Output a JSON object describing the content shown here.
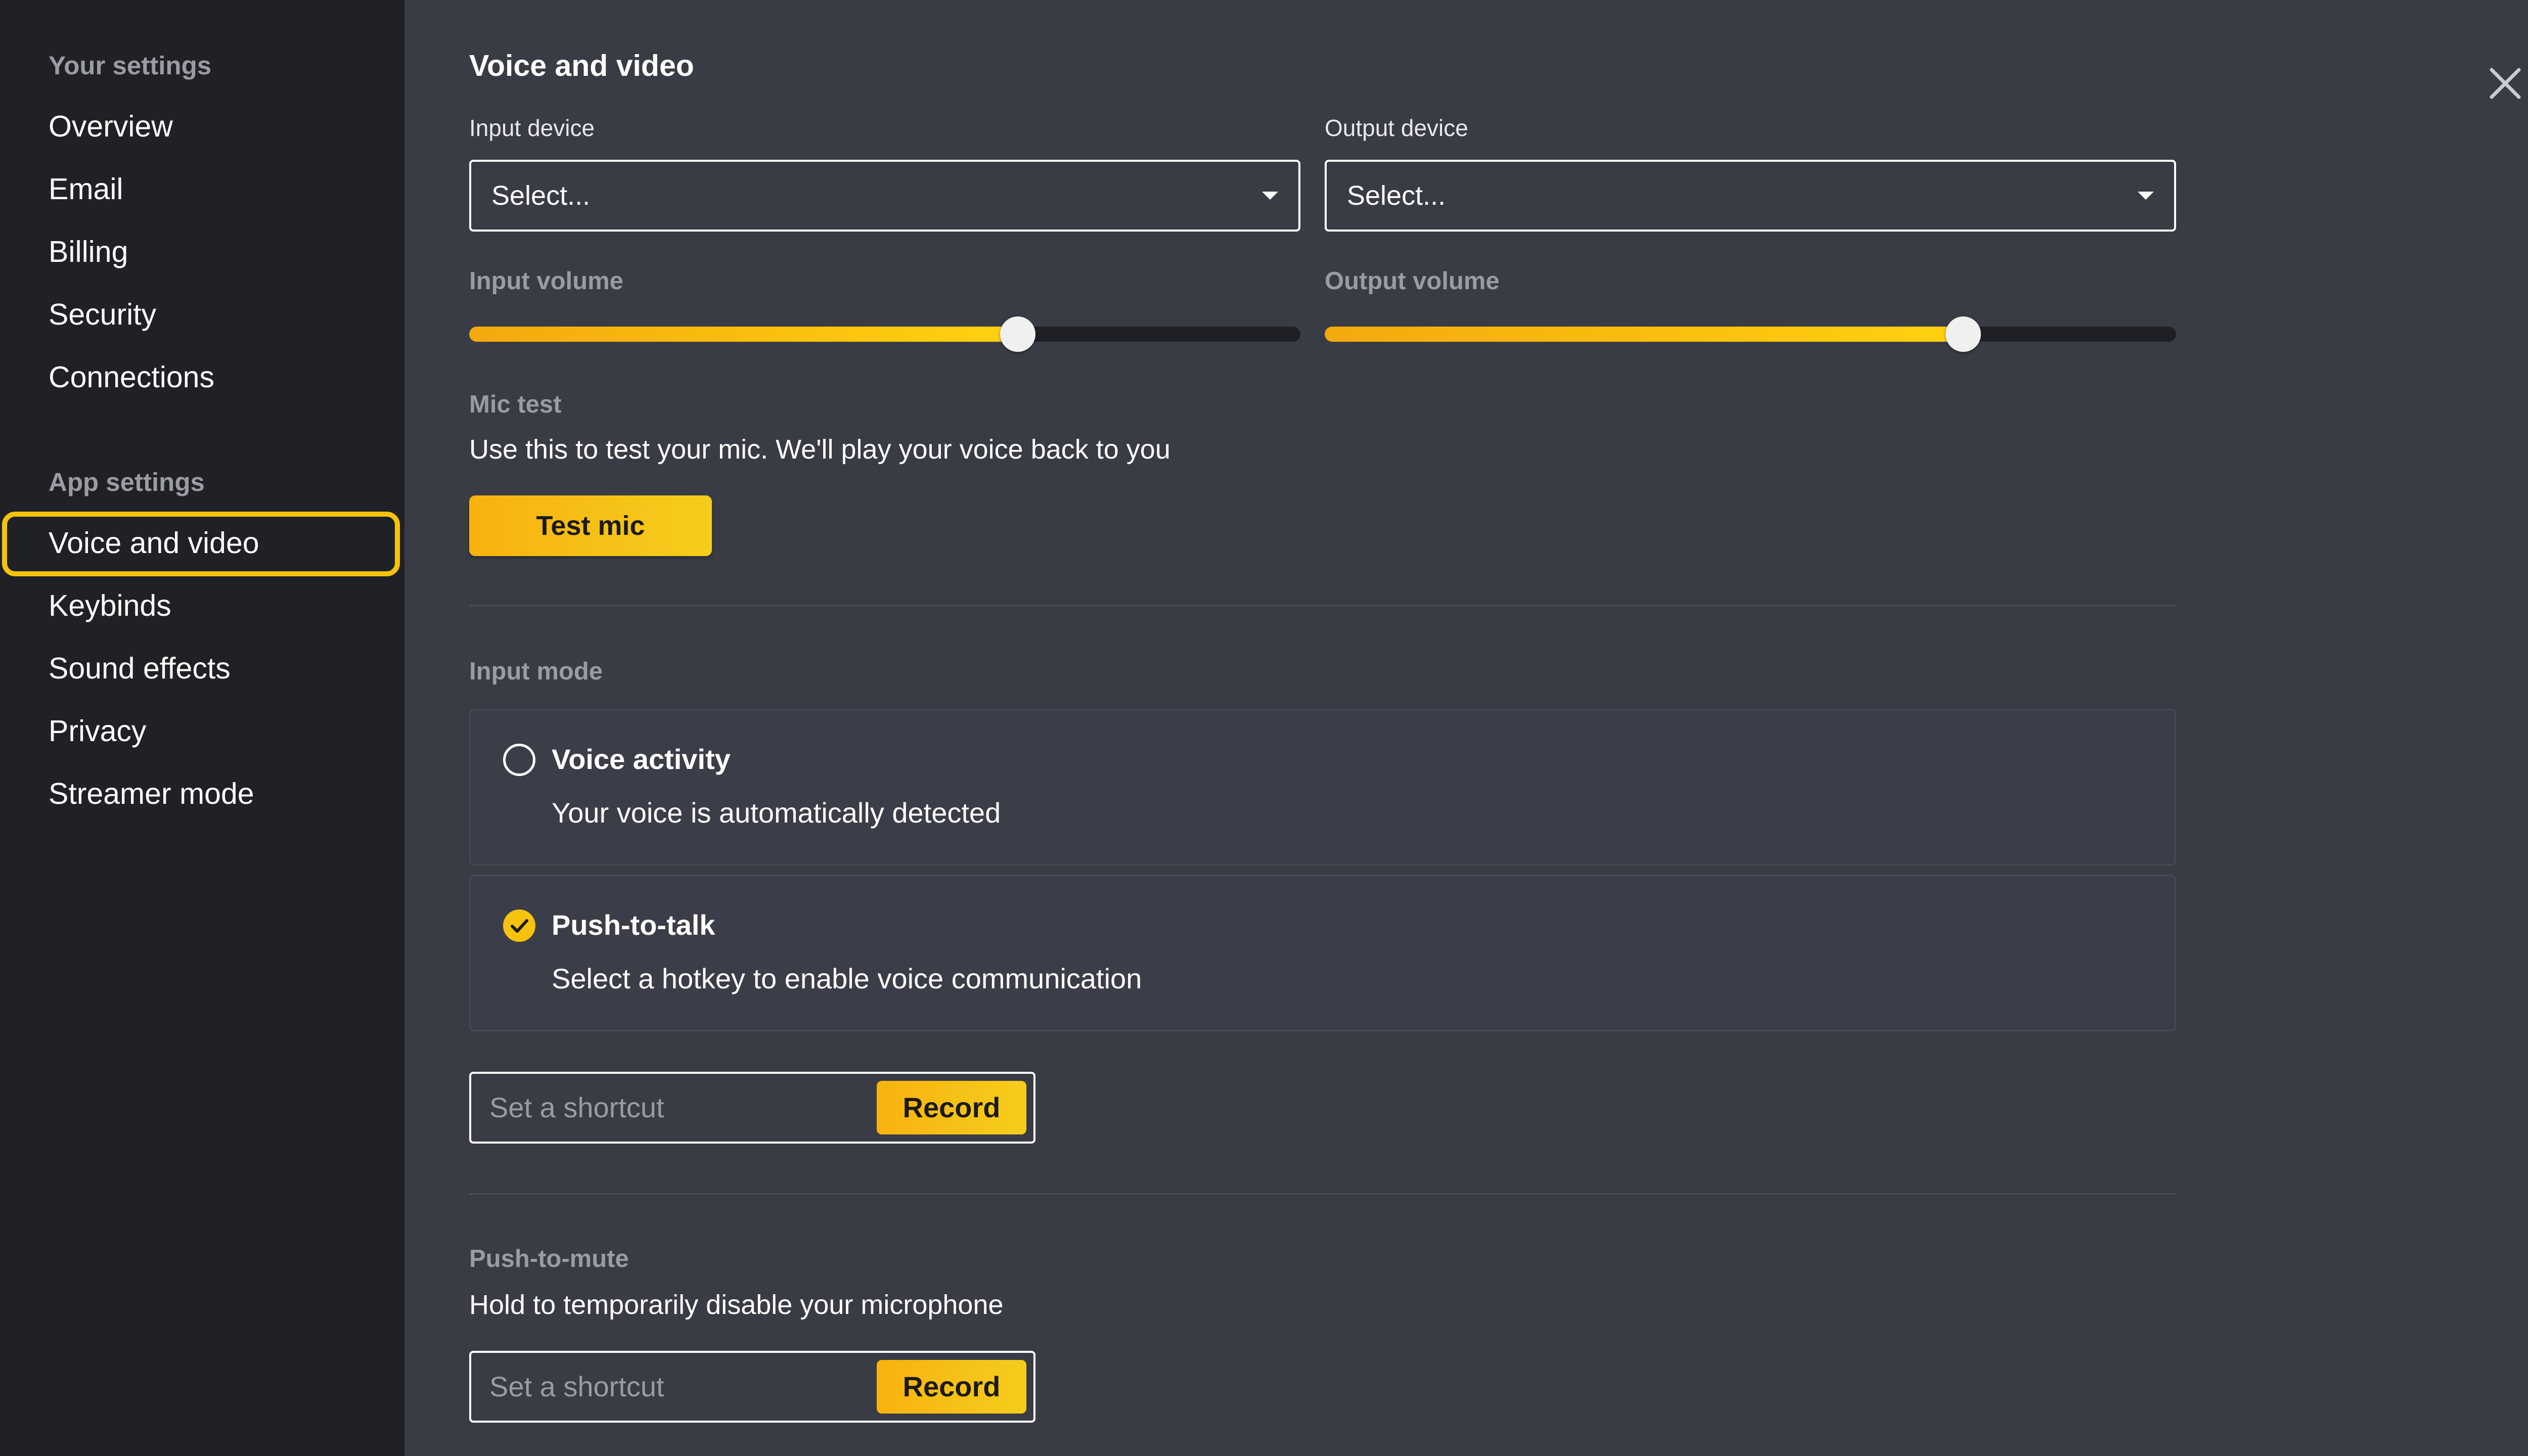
{
  "sidebar": {
    "your_settings_heading": "Your settings",
    "your_settings_items": [
      "Overview",
      "Email",
      "Billing",
      "Security",
      "Connections"
    ],
    "app_settings_heading": "App settings",
    "app_settings_items": [
      "Voice and video",
      "Keybinds",
      "Sound effects",
      "Privacy",
      "Streamer mode"
    ],
    "selected_item": "Voice and video"
  },
  "main": {
    "title": "Voice and video",
    "input_device": {
      "label": "Input device",
      "value": "Select..."
    },
    "output_device": {
      "label": "Output device",
      "value": "Select..."
    },
    "input_volume": {
      "label": "Input volume",
      "level_percent": 66
    },
    "output_volume": {
      "label": "Output volume",
      "level_percent": 75
    },
    "mic_test": {
      "label": "Mic test",
      "description": "Use this to test your mic. We'll play your voice back to you",
      "button_label": "Test mic"
    },
    "input_mode": {
      "label": "Input mode",
      "options": [
        {
          "title": "Voice activity",
          "description": "Your voice is automatically detected",
          "selected": false
        },
        {
          "title": "Push-to-talk",
          "description": "Select a hotkey to enable voice communication",
          "selected": true
        }
      ],
      "shortcut_placeholder": "Set a shortcut",
      "record_label": "Record"
    },
    "push_to_mute": {
      "label": "Push-to-mute",
      "description": "Hold to temporarily disable your microphone",
      "shortcut_placeholder": "Set a shortcut",
      "record_label": "Record"
    }
  },
  "colors": {
    "accent": "#f6c20e",
    "sidebar_bg": "#202126",
    "main_bg": "#393c45"
  },
  "icons": {
    "close": "close-icon",
    "dropdown": "chevron-down-icon",
    "checked": "check-circle-icon"
  }
}
